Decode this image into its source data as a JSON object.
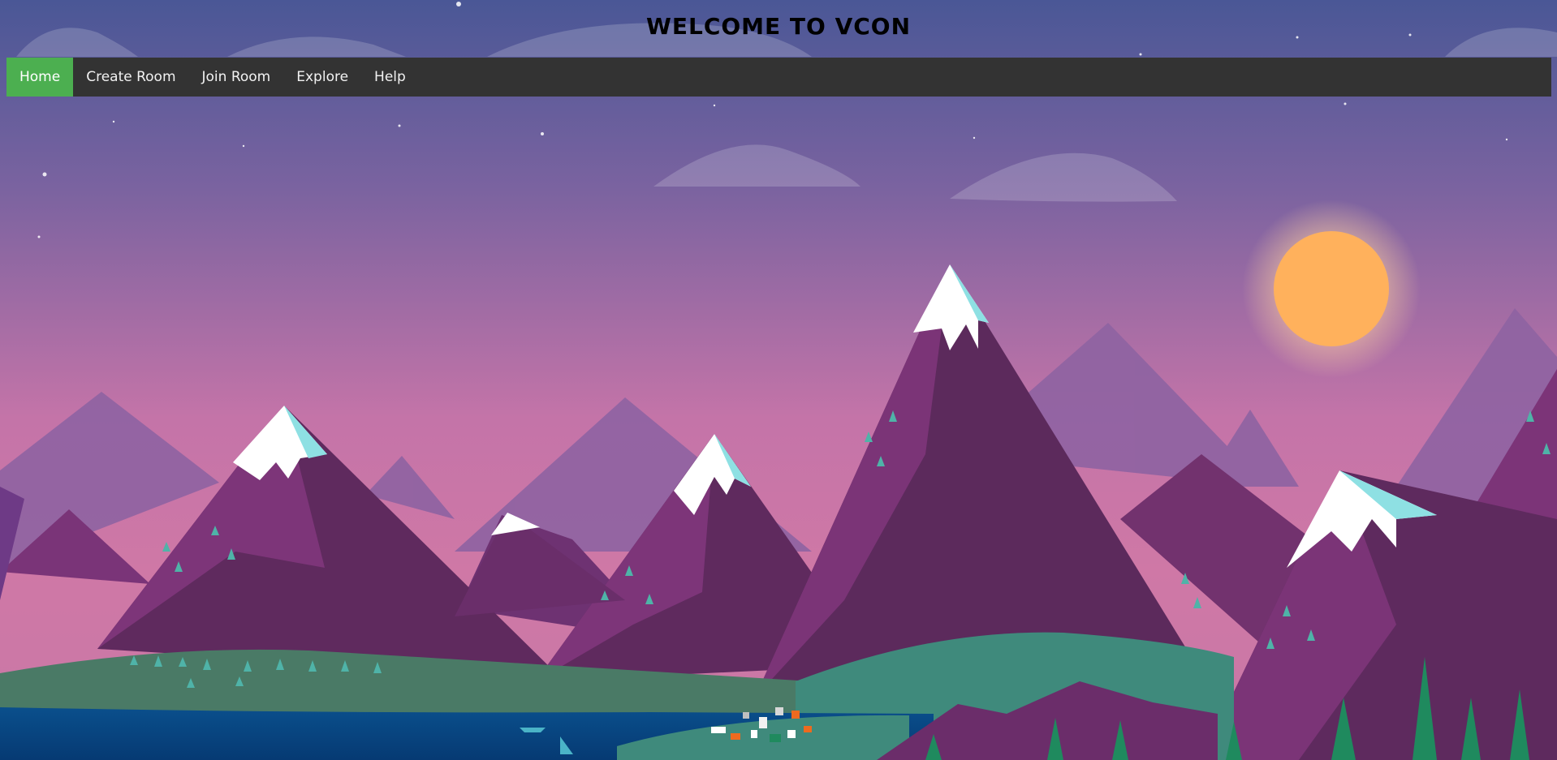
{
  "title": "WELCOME TO VCON",
  "nav": {
    "items": [
      {
        "label": "Home",
        "active": true
      },
      {
        "label": "Create Room",
        "active": false
      },
      {
        "label": "Join Room",
        "active": false
      },
      {
        "label": "Explore",
        "active": false
      },
      {
        "label": "Help",
        "active": false
      }
    ]
  },
  "colors": {
    "nav_background": "#333333",
    "nav_active": "#4caf50",
    "nav_text": "#f2f2f2",
    "sky_top": "#4a5796",
    "sky_bottom": "#cc74a6",
    "sun": "#ffb15c"
  },
  "background": {
    "scene": "mountain-landscape-illustration"
  }
}
